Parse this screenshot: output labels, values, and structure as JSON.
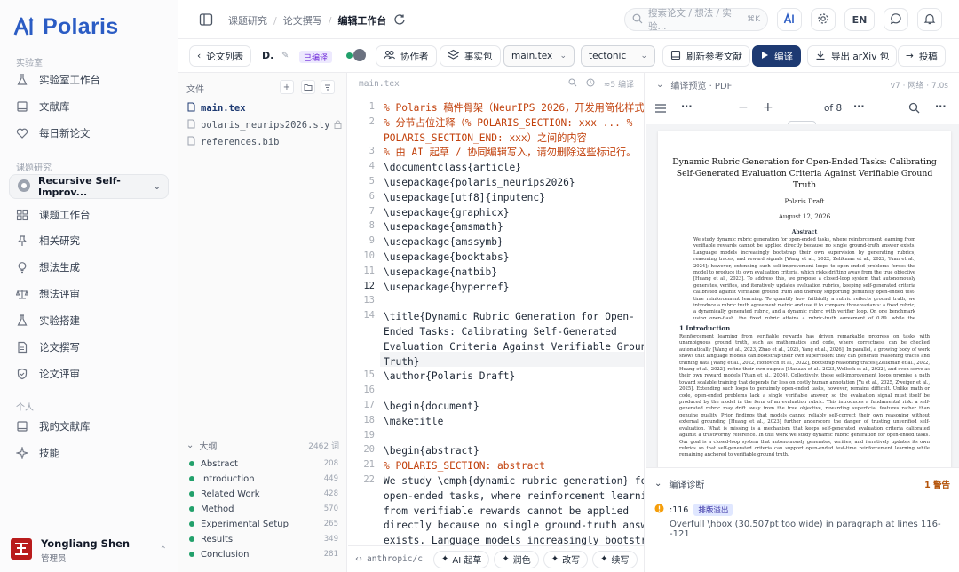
{
  "app": {
    "name": "Polaris",
    "brand_color": "#2b5cc4"
  },
  "sidebar": {
    "sections": [
      "实验室",
      "课题研究",
      "个人"
    ],
    "lab_items": [
      {
        "label": "实验室工作台",
        "icon": "flask-icon"
      },
      {
        "label": "文献库",
        "icon": "book-icon"
      },
      {
        "label": "每日新论文",
        "icon": "heart-icon"
      }
    ],
    "project": {
      "label": "Recursive Self-Improv..."
    },
    "research_items": [
      {
        "label": "课题工作台",
        "icon": "grid-icon"
      },
      {
        "label": "相关研究",
        "icon": "pin-icon"
      },
      {
        "label": "想法生成",
        "icon": "bulb-icon"
      },
      {
        "label": "想法评审",
        "icon": "scale-icon"
      },
      {
        "label": "实验搭建",
        "icon": "flask-icon"
      },
      {
        "label": "论文撰写",
        "icon": "doc-icon"
      },
      {
        "label": "论文评审",
        "icon": "shield-icon"
      }
    ],
    "personal_items": [
      {
        "label": "我的文献库",
        "icon": "book-icon"
      },
      {
        "label": "技能",
        "icon": "sparkle-icon"
      }
    ],
    "user": {
      "name": "Yongliang Shen",
      "role": "管理员"
    }
  },
  "topbar": {
    "breadcrumb": [
      "课题研究",
      "论文撰写",
      "编辑工作台"
    ],
    "search_placeholder": "搜索论文 / 想法 / 实验...",
    "search_shortcut": "⌘K",
    "lang": "EN"
  },
  "toolbar": {
    "back_label": "论文列表",
    "doc_title": "D.",
    "status": "已编译",
    "collaborators_label": "协作者",
    "facts_label": "事实包",
    "main_file": "main.tex",
    "engine": "tectonic",
    "refresh_refs_label": "刷新参考文献",
    "compile_label": "编译",
    "export_label": "导出 arXiv 包",
    "submit_label": "投稿"
  },
  "files": {
    "header": "文件",
    "items": [
      {
        "name": "main.tex",
        "active": true
      },
      {
        "name": "polaris_neurips2026.sty",
        "locked": true
      },
      {
        "name": "references.bib"
      }
    ]
  },
  "outline": {
    "header": "大纲",
    "total": "2462 词",
    "items": [
      {
        "label": "Abstract",
        "count": "208"
      },
      {
        "label": "Introduction",
        "count": "449"
      },
      {
        "label": "Related Work",
        "count": "428"
      },
      {
        "label": "Method",
        "count": "570"
      },
      {
        "label": "Experimental Setup",
        "count": "265"
      },
      {
        "label": "Results",
        "count": "349"
      },
      {
        "label": "Conclusion",
        "count": "281"
      }
    ]
  },
  "editor": {
    "file": "main.tex",
    "meta": "≈5 编译",
    "lines": [
      {
        "n": "1",
        "text": "% Polaris 稿件骨架（NeurIPS 2026，开发用简化样式）",
        "type": "comment"
      },
      {
        "n": "2",
        "text": "% 分节占位注释（% POLARIS_SECTION: xxx ... %",
        "type": "comment"
      },
      {
        "n": "",
        "text": "POLARIS_SECTION_END: xxx）之间的内容",
        "type": "comment"
      },
      {
        "n": "3",
        "text": "% 由 AI 起草 / 协同编辑写入，请勿删除这些标记行。",
        "type": "comment"
      },
      {
        "n": "4",
        "text": "\\documentclass{article}",
        "type": "code"
      },
      {
        "n": "5",
        "text": "\\usepackage{polaris_neurips2026}",
        "type": "code"
      },
      {
        "n": "6",
        "text": "\\usepackage[utf8]{inputenc}",
        "type": "code"
      },
      {
        "n": "7",
        "text": "\\usepackage{graphicx}",
        "type": "code"
      },
      {
        "n": "8",
        "text": "\\usepackage{amsmath}",
        "type": "code"
      },
      {
        "n": "9",
        "text": "\\usepackage{amssymb}",
        "type": "code"
      },
      {
        "n": "10",
        "text": "\\usepackage{booktabs}",
        "type": "code"
      },
      {
        "n": "11",
        "text": "\\usepackage{natbib}",
        "type": "code"
      },
      {
        "n": "12",
        "text": "\\usepackage{hyperref}",
        "type": "code"
      },
      {
        "n": "13",
        "text": "",
        "type": "code"
      },
      {
        "n": "14",
        "text": "\\title{Dynamic Rubric Generation for Open-",
        "type": "code"
      },
      {
        "n": "",
        "text": "Ended Tasks: Calibrating Self-Generated",
        "type": "code"
      },
      {
        "n": "",
        "text": "Evaluation Criteria Against Verifiable Ground",
        "type": "code"
      },
      {
        "n": "",
        "text": "Truth}",
        "type": "code"
      },
      {
        "n": "15",
        "text": "\\author{Polaris Draft}",
        "type": "code"
      },
      {
        "n": "16",
        "text": "",
        "type": "code"
      },
      {
        "n": "17",
        "text": "\\begin{document}",
        "type": "code"
      },
      {
        "n": "18",
        "text": "\\maketitle",
        "type": "code"
      },
      {
        "n": "19",
        "text": "",
        "type": "code"
      },
      {
        "n": "20",
        "text": "\\begin{abstract}",
        "type": "code"
      },
      {
        "n": "21",
        "text": "% POLARIS_SECTION: abstract",
        "type": "comment"
      },
      {
        "n": "22",
        "text": "We study \\emph{dynamic rubric generation} for",
        "type": "code"
      },
      {
        "n": "",
        "text": "open-ended tasks, where reinforcement learning",
        "type": "code"
      },
      {
        "n": "",
        "text": "from verifiable rewards cannot be applied",
        "type": "code"
      },
      {
        "n": "",
        "text": "directly because no single ground-truth answer",
        "type": "code"
      },
      {
        "n": "",
        "text": "exists. Language models increasingly bootstrap",
        "type": "code"
      }
    ],
    "footer": {
      "path": "anthropic/c",
      "ai_draft": "AI 起草",
      "polish": "润色",
      "rewrite": "改写",
      "continue": "续写"
    }
  },
  "preview": {
    "header": "编译预览 · PDF",
    "meta": "v7 · 网络 · 7.0s",
    "page_current": "1",
    "page_total": "of 8",
    "paper": {
      "title": "Dynamic Rubric Generation for Open-Ended Tasks: Calibrating Self-Generated Evaluation Criteria Against Verifiable Ground Truth",
      "author": "Polaris Draft",
      "date": "August 12, 2026",
      "abstract_heading": "Abstract",
      "abstract": "We study dynamic rubric generation for open-ended tasks, where reinforcement learning from verifiable rewards cannot be applied directly because no single ground-truth answer exists. Language models increasingly bootstrap their own supervision by generating rubrics, reasoning traces, and reward signals [Wang et al., 2022, Zelikman et al., 2022, Yuan et al., 2024]; however, extending such self-improvement loops to open-ended problems forces the model to produce its own evaluation criteria, which risks drifting away from the true objective [Huang et al., 2023]. To address this, we propose a closed-loop system that autonomously generates, verifies, and iteratively updates evaluation rubrics, keeping self-generated criteria calibrated against verifiable ground truth and thereby supporting genuinely open-ended test-time reinforcement learning. To quantify how faithfully a rubric reflects ground truth, we introduce a rubric truth agreement metric and use it to compare three variants: a fixed rubric, a dynamically generated rubric, and a dynamic rubric with verifier loop. On one benchmark using open-flash, the fixed rubric attains a rubric-truth agreement of 0.89, while the dynamically generated rubric and the dynamic rubric with voting reach 0.96 and 0.95 respectively. These results show that self-generated rubrics can approach the reliability of fixed references while retaining the flexibility needed for open-ended evaluation, and they highlight the trade-off between adaptivity and calibration that any open-ended self-improvement loop must navigate.",
      "section_heading": "1   Introduction",
      "intro": "Reinforcement learning from verifiable rewards has driven remarkable progress on tasks with unambiguous ground truth, such as mathematics and code, where correctness can be checked automatically [Wang et al., 2023, Zhao et al., 2025, Yang et al., 2026]. In parallel, a growing body of work shows that language models can bootstrap their own supervision: they can generate reasoning traces and training data [Wang et al., 2022, Honovich et al., 2022], bootstrap reasoning traces [Zelikman et al., 2022, Huang et al., 2022], refine their own outputs [Madaan et al., 2023, Welleck et al., 2022], and even serve as their own reward models [Yuan et al., 2024]. Collectively, these self-improvement loops promise a path toward scalable training that depends far less on costly human annotation [Yu et al., 2025, Zweiger et al., 2025]. Extending such loops to genuinely open-ended tasks, however, remains difficult. Unlike math or code, open-ended problems lack a single verifiable answer, so the evaluation signal must itself be produced by the model in the form of an evaluation rubric. This introduces a fundamental risk: a self-generated rubric may drift away from the true objective, rewarding superficial features rather than genuine quality. Prior findings that models cannot reliably self-correct their own reasoning without external grounding [Huang et al., 2023] further underscore the danger of trusting unverified self-evaluation. What is missing is a mechanism that keeps self-generated evaluation criteria calibrated against a trustworthy reference. In this work we study dynamic rubric generation for open-ended tasks. Our goal is a closed-loop system that autonomously generates, verifies, and iteratively updates its own rubrics so that self-generated criteria can support open-ended test-time reinforcement learning while remaining anchored to verifiable ground truth."
    },
    "diagnostics": {
      "header": "编译诊断",
      "count": "1 警告",
      "line": ":116",
      "tag": "排版溢出",
      "message": "Overfull \\hbox (30.507pt too wide) in paragraph at lines 116--121"
    }
  }
}
